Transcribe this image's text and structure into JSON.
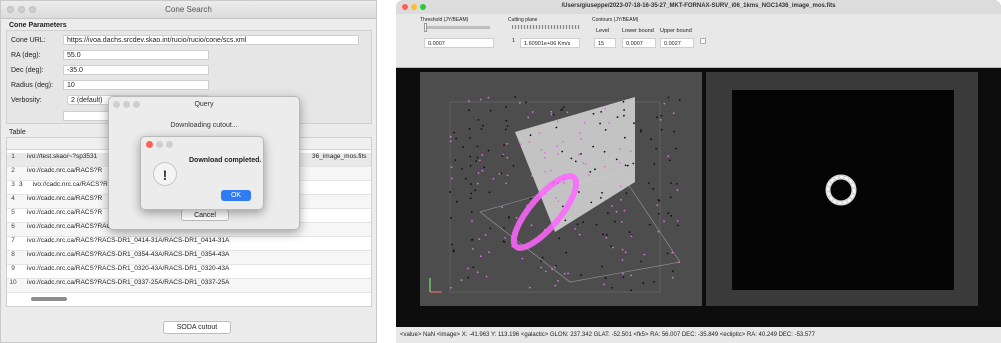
{
  "left_window": {
    "title": "Cone Search",
    "group_title": "Cone Parameters",
    "fields": {
      "cone_url_label": "Cone URL:",
      "cone_url_value": "https://ivoa.dachs.srcdev.skao.int/rucio/rucio/cone/scs.xml",
      "ra_label": "RA (deg):",
      "ra_value": "55.0",
      "dec_label": "Dec (deg):",
      "dec_value": "-35.0",
      "radius_label": "Radius (deg):",
      "radius_value": "10",
      "verbosity_label": "Verbosity:",
      "verbosity_value": "2 (default)"
    },
    "table_label": "Table",
    "rows": [
      {
        "num": "1",
        "value": "ivo://test.skao/~?sp3531",
        "tail": "36_image_mos.fits"
      },
      {
        "num": "2",
        "value": "ivo://cadc.nrc.ca/RACS?R"
      },
      {
        "num": "3",
        "value": "ivo://cadc.nrc.ca/RACS?R"
      },
      {
        "num": "4",
        "value": "ivo://cadc.nrc.ca/RACS?R"
      },
      {
        "num": "5",
        "value": "ivo://cadc.nrc.ca/RACS?R"
      },
      {
        "num": "6",
        "value": "ivo://cadc.nrc.ca/RACS?RACS-DR1_0330-35A/RACS-DR1_0330-35A"
      },
      {
        "num": "7",
        "value": "ivo://cadc.nrc.ca/RACS?RACS-DR1_0414-31A/RACS-DR1_0414-31A"
      },
      {
        "num": "8",
        "value": "ivo://cadc.nrc.ca/RACS?RACS-DR1_0354-43A/RACS-DR1_0354-43A"
      },
      {
        "num": "9",
        "value": "ivo://cadc.nrc.ca/RACS?RACS-DR1_0320-43A/RACS-DR1_0320-43A"
      },
      {
        "num": "10",
        "value": "ivo://cadc.nrc.ca/RACS?RACS-DR1_0337-25A/RACS-DR1_0337-25A"
      }
    ],
    "row3_extra": "3",
    "soda_button": "SODA cutout"
  },
  "query_dialog": {
    "title": "Query",
    "message": "Downloading cutout...",
    "cancel": "Cancel"
  },
  "alert_dialog": {
    "message": "Download completed.",
    "ok": "OK",
    "icon": "exclamation-icon"
  },
  "right_window": {
    "title": "/Users/giuseppe/2023-07-18-16-35-27_MKT-FORNAX-SURV_i06_1kms_NGC1436_image_mos.fits",
    "threshold_label": "Threshold (JY/BEAM)",
    "threshold_value": "0.0007",
    "cutting_label": "Cutting plane",
    "cutting_index": "1",
    "cutting_value": "1.60901e+06 Km/s",
    "contours_label": "Contours (JY/BEAM)",
    "level_label": "Level",
    "level_value": "15",
    "lower_label": "Lower bound",
    "lower_value": "0.0007",
    "upper_label": "Upper bound",
    "upper_value": "0.0027",
    "status": "<value> NaN <image> X: -41.963 Y: 113.196 <galactic> GLON: 237.342 GLAT: -52.501 <fk5> RA: 56.007 DEC: -35.849 <ecliptic> RA: 40.249 DEC: -53.577",
    "accent": "#ff66ff"
  }
}
